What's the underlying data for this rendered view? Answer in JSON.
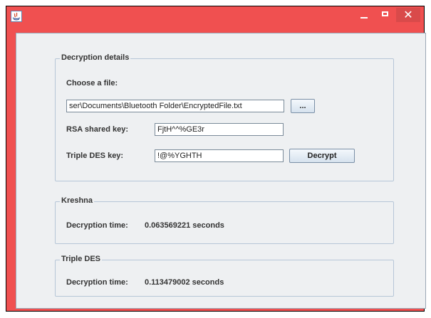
{
  "window": {
    "close_glyph": "✕"
  },
  "decryption": {
    "legend": "Decryption details",
    "choose_file_label": "Choose a file:",
    "file_path": "ser\\Documents\\Bluetooth Folder\\EncryptedFile.txt",
    "browse_label": "...",
    "rsa_label": "RSA shared key:",
    "rsa_value": "FjtH^^%GE3r",
    "tdes_label": "Triple DES key:",
    "tdes_value": "!@%YGHTH",
    "decrypt_label": "Decrypt"
  },
  "kreshna": {
    "legend": "Kreshna",
    "time_label": "Decryption time:",
    "time_value": "0.063569221 seconds"
  },
  "triple_des": {
    "legend": "Triple DES",
    "time_label": "Decryption time:",
    "time_value": "0.113479002 seconds"
  }
}
